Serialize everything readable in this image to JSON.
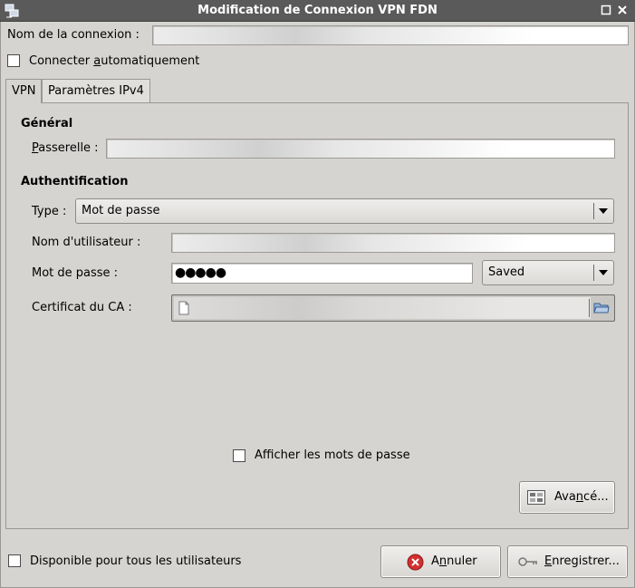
{
  "window": {
    "title": "Modification de Connexion VPN FDN",
    "icons": {
      "app": "network-icon",
      "minimize": "minimize-icon",
      "close": "close-icon"
    }
  },
  "connection_name": {
    "label": "Nom de la connexion :",
    "value": ""
  },
  "autoconnect": {
    "label_pre": "Connecter ",
    "label_u": "a",
    "label_post": "utomatiquement",
    "checked": false
  },
  "tabs": [
    {
      "label": "VPN",
      "active": true
    },
    {
      "label": "Paramètres IPv4",
      "active": false
    }
  ],
  "general": {
    "heading": "Général",
    "gateway": {
      "label_u": "P",
      "label_post": "asserelle :",
      "value": ""
    }
  },
  "auth": {
    "heading": "Authentification",
    "type": {
      "label": "Type :",
      "value": "Mot de passe"
    },
    "username": {
      "label": "Nom d'utilisateur :",
      "value": ""
    },
    "password": {
      "label": "Mot de passe :",
      "value": "●●●●●",
      "storage": "Saved"
    },
    "ca_cert": {
      "label": "Certificat du CA :",
      "value": ""
    }
  },
  "show_passwords": {
    "label": "Afficher les mots de passe",
    "checked": false
  },
  "advanced_button": {
    "label_pre": "Ava",
    "label_u": "n",
    "label_post": "cé...",
    "icon": "advanced-settings-icon"
  },
  "available_all_users": {
    "label": "Disponible pour tous les utilisateurs",
    "checked": false
  },
  "cancel_button": {
    "label_pre": "A",
    "label_u": "n",
    "label_post": "nuler",
    "icon": "cancel-icon",
    "icon_color": "#d32f2f"
  },
  "save_button": {
    "label_pre": "",
    "label_u": "E",
    "label_post": "nregistrer...",
    "icon": "key-icon"
  }
}
